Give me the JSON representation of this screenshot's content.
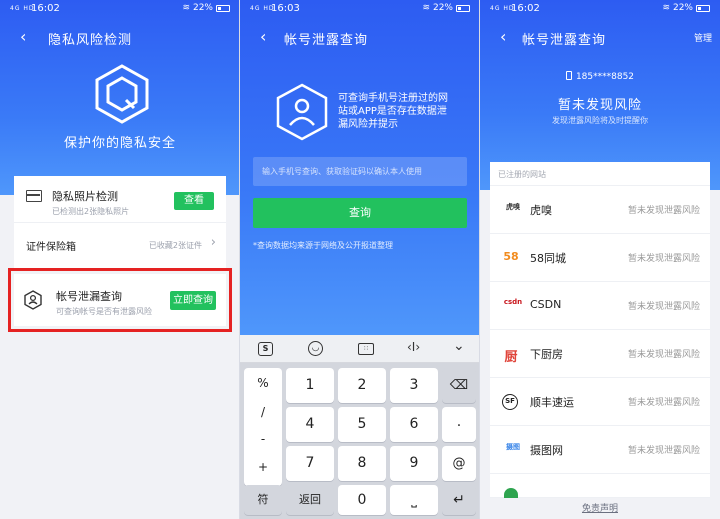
{
  "s1": {
    "status": {
      "sig": "4G HD",
      "time": "16:02",
      "battery": "22%"
    },
    "title": "隐私风险检测",
    "slogan": "保护你的隐私安全",
    "photo": {
      "title": "隐私照片检测",
      "sub": "已检测出2张隐私照片",
      "btn": "查看"
    },
    "vault": {
      "title": "证件保险箱",
      "right": "已收藏2张证件"
    },
    "leak": {
      "title": "帐号泄漏查询",
      "sub": "可查询帐号是否有泄露风险",
      "btn": "立即查询"
    }
  },
  "s2": {
    "status": {
      "sig": "4G HD",
      "time": "16:03",
      "battery": "22%"
    },
    "title": "帐号泄露查询",
    "desc": "可查询手机号注册过的网站或APP是否存在数据泄漏风险并提示",
    "placeholder": "输入手机号查询、获取验证码以确认本人使用",
    "btn": "查询",
    "note": "*查询数据均来源于网络及公开报道整理",
    "toolbar": [
      "keyboard-icon",
      "emoji-icon",
      "keyboard-grid-icon",
      "cursor-icon",
      "chevron-down-icon"
    ],
    "keys": {
      "left": [
        "%",
        "/",
        "-",
        "+"
      ],
      "r1": [
        "1",
        "2",
        "3"
      ],
      "r2": [
        "4",
        "5",
        "6"
      ],
      "r3": [
        "7",
        "8",
        "9"
      ],
      "right": [
        "⌫",
        ".",
        "@"
      ],
      "bottom": {
        "fu": "符",
        "back": "返回",
        "zero": "0",
        "space": "⎵",
        "enter": "↵"
      }
    }
  },
  "s3": {
    "status": {
      "sig": "4G HD",
      "time": "16:02",
      "battery": "22%"
    },
    "title": "帐号泄露查询",
    "manage": "管理",
    "phone": "185****8852",
    "result": "暂未发现风险",
    "result_sub": "发现泄露风险将及时提醒你",
    "section": "已注册的网站",
    "sites": [
      {
        "logo": "虎嗅",
        "name": "虎嗅",
        "status": "暂未发现泄露风险",
        "color": "#333333"
      },
      {
        "logo": "58",
        "name": "58同城",
        "status": "暂未发现泄露风险",
        "color": "#f28c1f"
      },
      {
        "logo": "csdn",
        "name": "CSDN",
        "status": "暂未发现泄露风险",
        "color": "#c8161d"
      },
      {
        "logo": "厨",
        "name": "下厨房",
        "status": "暂未发现泄露风险",
        "color": "#e0453b"
      },
      {
        "logo": "SF",
        "name": "顺丰速运",
        "status": "暂未发现泄露风险",
        "color": "#222222"
      },
      {
        "logo": "摄图",
        "name": "摄图网",
        "status": "暂未发现泄露风险",
        "color": "#3b86e8"
      }
    ],
    "disclaimer": "免责声明"
  },
  "colors": {
    "blue": "#2d5cf2",
    "green": "#22c15e",
    "red": "#e52222"
  }
}
